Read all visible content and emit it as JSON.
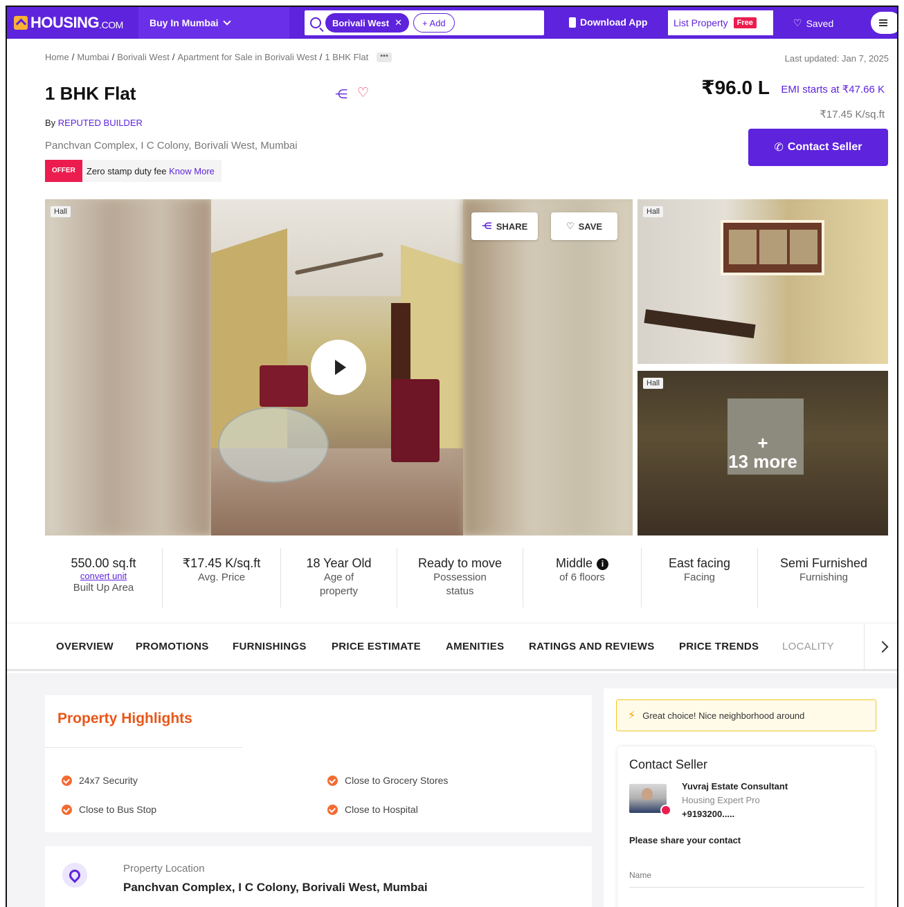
{
  "nav": {
    "logo": "HOUSING",
    "logo_suffix": ".COM",
    "city": "Buy In Mumbai",
    "search_chip": "Borivali West",
    "add_label": "+ Add",
    "download": "Download App",
    "list_property": "List Property",
    "free_badge": "Free",
    "saved": "Saved"
  },
  "breadcrumb": [
    "Home",
    "Mumbai",
    "Borivali West",
    "Apartment for Sale in Borivali West",
    "1 BHK Flat"
  ],
  "last_updated": "Last updated: Jan 7, 2025",
  "property": {
    "title": "1 BHK Flat",
    "by": "By",
    "builder": "REPUTED BUILDER",
    "address": "Panchvan Complex, I C Colony, Borivali West, Mumbai",
    "offer_tag": "OFFER",
    "offer_text": "Zero stamp duty fee",
    "offer_link": "Know More",
    "price": "₹96.0 L",
    "emi": "EMI starts at ₹47.66 K",
    "per_sqft": "₹17.45 K/sq.ft",
    "contact_btn": "Contact Seller"
  },
  "gallery": {
    "tag_main": "Hall",
    "tag_side1": "Hall",
    "tag_side2": "Hall",
    "share": "SHARE",
    "save": "SAVE",
    "plus": "+",
    "more": "13 more"
  },
  "stats": [
    {
      "value": "550.00 sq.ft",
      "convert": "convert unit",
      "label": "Built Up Area"
    },
    {
      "value": "₹17.45 K/sq.ft",
      "label": "Avg. Price"
    },
    {
      "value": "18 Year Old",
      "label": "Age of property"
    },
    {
      "value": "Ready to move",
      "label": "Possession status"
    },
    {
      "value": "Middle",
      "label": "of 6 floors"
    },
    {
      "value": "East facing",
      "label": "Facing"
    },
    {
      "value": "Semi Furnished",
      "label": "Furnishing"
    }
  ],
  "tabs": [
    "OVERVIEW",
    "PROMOTIONS",
    "FURNISHINGS",
    "PRICE ESTIMATE",
    "AMENITIES",
    "RATINGS AND REVIEWS",
    "PRICE TRENDS",
    "LOCALITY"
  ],
  "highlights": {
    "title": "Property Highlights",
    "items": [
      "24x7 Security",
      "Close to Grocery Stores",
      "Close to Bus Stop",
      "Close to Hospital"
    ]
  },
  "location": {
    "label": "Property Location",
    "value": "Panchvan Complex, I C Colony, Borivali West, Mumbai"
  },
  "sidebar": {
    "great": "Great choice! Nice neighborhood around",
    "contact_title": "Contact Seller",
    "agent_name": "Yuvraj Estate Consultant",
    "agent_sub": "Housing Expert Pro",
    "agent_phone": "+9193200.....",
    "share_contact": "Please share your contact",
    "name_placeholder": "Name"
  },
  "colors": {
    "brand": "#5e23dc",
    "offer": "#ec1c4f",
    "highlight": "#e8571a"
  }
}
